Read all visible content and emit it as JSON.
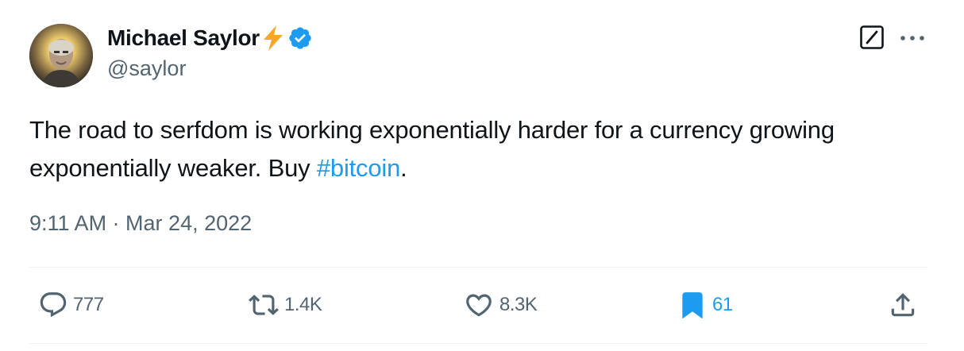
{
  "author": {
    "display_name": "Michael Saylor",
    "handle": "@saylor",
    "name_emoji": "lightning-bolt-icon",
    "verified": true,
    "verified_color": "#1d9bf0",
    "bolt_color": "#f7a823"
  },
  "tweet": {
    "text_before": "The road to serfdom is working exponentially harder for a currency growing exponentially weaker. Buy ",
    "hashtag": "#bitcoin",
    "text_after": ".",
    "timestamp": "9:11 AM · Mar 24, 2022"
  },
  "actions": {
    "replies": "777",
    "reposts": "1.4K",
    "likes": "8.3K",
    "bookmarks": "61"
  },
  "colors": {
    "text_primary": "#0f1419",
    "text_secondary": "#536471",
    "accent": "#1d9bf0",
    "divider": "#eff3f4"
  }
}
